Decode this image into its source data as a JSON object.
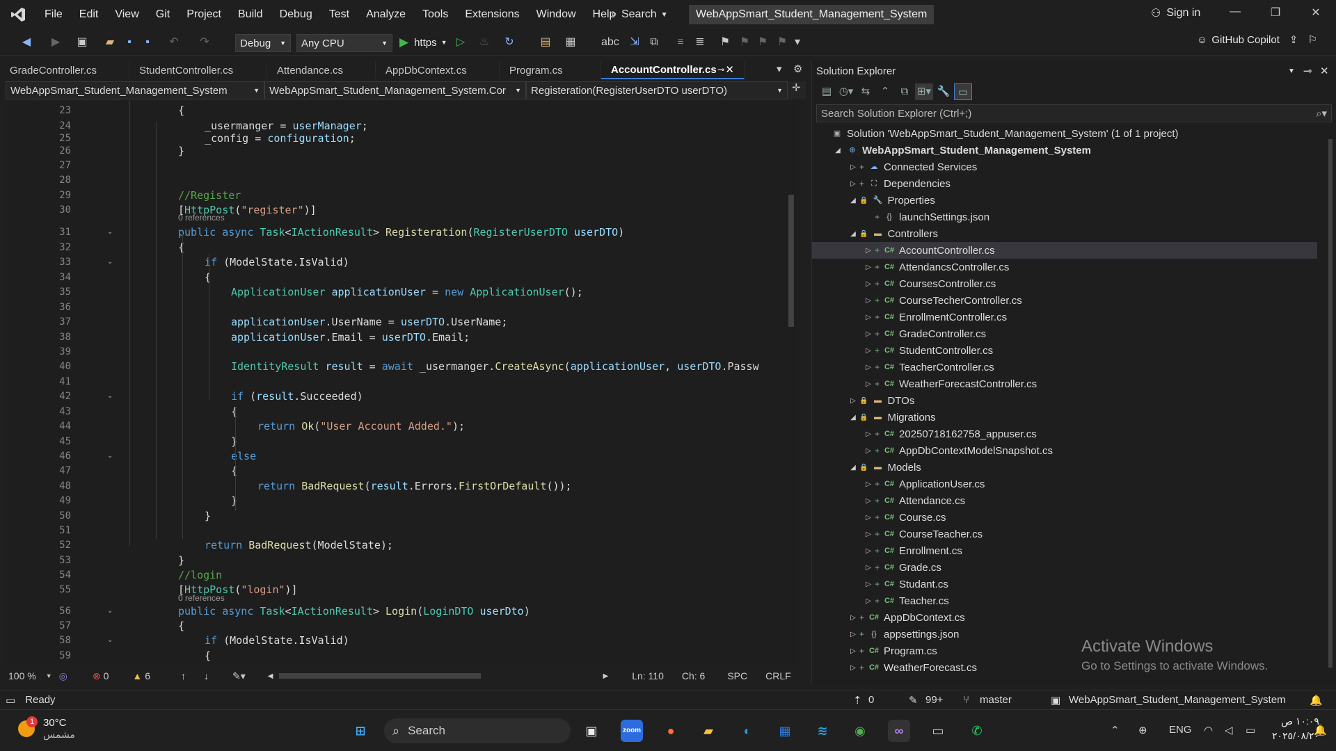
{
  "titlebar": {
    "menu": [
      "File",
      "Edit",
      "View",
      "Git",
      "Project",
      "Build",
      "Debug",
      "Test",
      "Analyze",
      "Tools",
      "Extensions",
      "Window",
      "Help"
    ],
    "search": "Search",
    "solution_title": "WebAppSmart_Student_Management_System",
    "sign_in": "Sign in"
  },
  "toolbar": {
    "config": "Debug",
    "platform": "Any CPU",
    "run_target": "https",
    "copilot": "GitHub Copilot"
  },
  "tabs": [
    "GradeController.cs",
    "StudentController.cs",
    "Attendance.cs",
    "AppDbContext.cs",
    "Program.cs",
    "AccountController.cs"
  ],
  "navbar": {
    "project": "WebAppSmart_Student_Management_System",
    "class": "WebAppSmart_Student_Management_System.Cor",
    "member": "Registeration(RegisterUserDTO userDTO)"
  },
  "code": {
    "refs": "0 references",
    "line_numbers": [
      "23",
      "24",
      "25",
      "26",
      "27",
      "28",
      "29",
      "30",
      "31",
      "32",
      "33",
      "34",
      "35",
      "36",
      "37",
      "38",
      "39",
      "40",
      "41",
      "42",
      "43",
      "44",
      "45",
      "46",
      "47",
      "48",
      "49",
      "50",
      "51",
      "52",
      "53",
      "54",
      "55",
      "56",
      "57",
      "58",
      "59"
    ]
  },
  "editor_status": {
    "zoom": "100 %",
    "errors": "0",
    "warnings": "6",
    "ln": "Ln: 110",
    "ch": "Ch: 6",
    "spc": "SPC",
    "crlf": "CRLF"
  },
  "solution_explorer": {
    "title": "Solution Explorer",
    "search_placeholder": "Search Solution Explorer (Ctrl+;)",
    "items": [
      "Solution 'WebAppSmart_Student_Management_System' (1 of 1 project)",
      "WebAppSmart_Student_Management_System",
      "Connected Services",
      "Dependencies",
      "Properties",
      "launchSettings.json",
      "Controllers",
      "AccountController.cs",
      "AttendancsController.cs",
      "CoursesController.cs",
      "CourseTecherController.cs",
      "EnrollmentController.cs",
      "GradeController.cs",
      "StudentController.cs",
      "TeacherController.cs",
      "WeatherForecastController.cs",
      "DTOs",
      "Migrations",
      "20250718162758_appuser.cs",
      "AppDbContextModelSnapshot.cs",
      "Models",
      "ApplicationUser.cs",
      "Attendance.cs",
      "Course.cs",
      "CourseTeacher.cs",
      "Enrollment.cs",
      "Grade.cs",
      "Studant.cs",
      "Teacher.cs",
      "AppDbContext.cs",
      "appsettings.json",
      "Program.cs",
      "WeatherForecast.cs"
    ],
    "activate_title": "Activate Windows",
    "activate_sub": "Go to Settings to activate Windows."
  },
  "statusbar": {
    "ready": "Ready",
    "up": "0",
    "pencil": "99+",
    "branch": "master",
    "repo": "WebAppSmart_Student_Management_System"
  },
  "taskbar": {
    "temp": "30°C",
    "weather": "مشمس",
    "badge": "1",
    "search": "Search",
    "lang": "ENG",
    "time": "١٠:٠٩ ص",
    "date": "٢٠٢٥/٠٨/٢٠"
  }
}
